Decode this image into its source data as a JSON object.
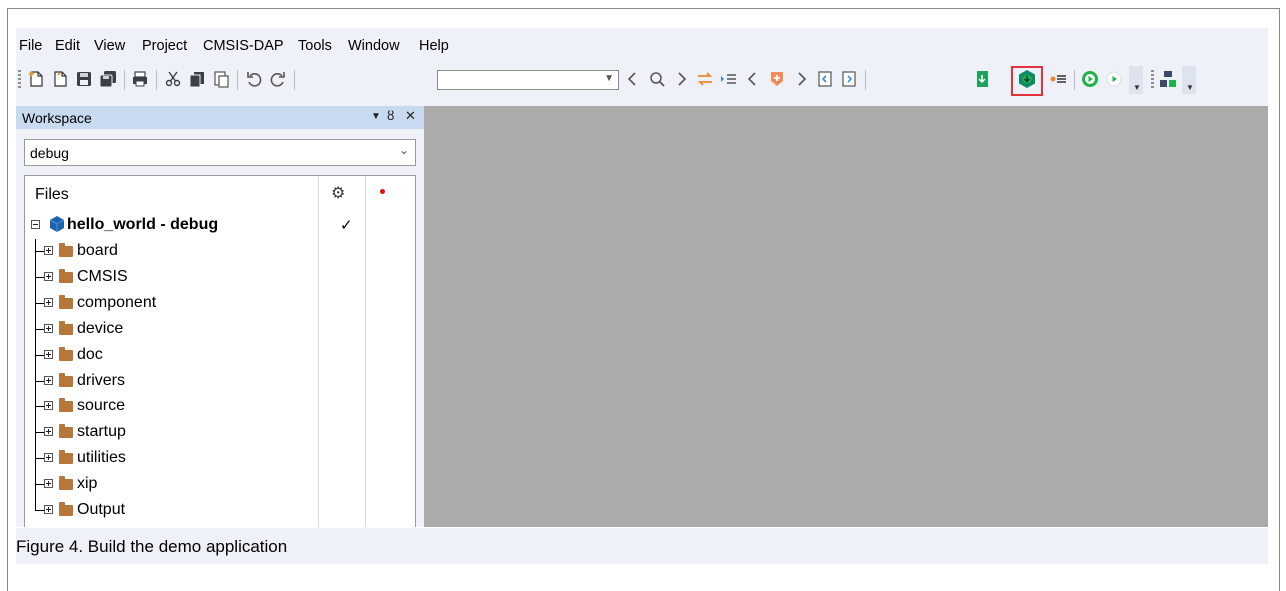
{
  "menu": {
    "items": [
      "File",
      "Edit",
      "View",
      "Project",
      "CMSIS-DAP",
      "Tools",
      "Window",
      "Help"
    ]
  },
  "toolbar": {
    "configuration_combo_value": "",
    "highlighted_button": "download-and-debug",
    "colors": {
      "highlight_border": "#e0333b",
      "run_green": "#1fb24a",
      "debug_teal": "#0d8a6a"
    }
  },
  "workspace": {
    "title": "Workspace",
    "pin_label": "ȣ",
    "close_label": "✕",
    "dropdown_label": "▼",
    "config_select": "debug",
    "files_header": "Files",
    "project": {
      "name": "hello_world - debug",
      "checked_mark": "✓"
    },
    "folders": [
      "board",
      "CMSIS",
      "component",
      "device",
      "doc",
      "drivers",
      "source",
      "startup",
      "utilities",
      "xip",
      "Output"
    ]
  },
  "caption": {
    "text": "Figure 4.  Build the demo application"
  }
}
